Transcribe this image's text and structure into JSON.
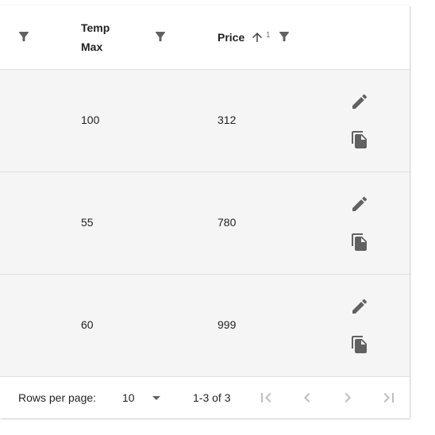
{
  "table": {
    "columns": [
      {
        "label": "",
        "filter_icon": "filter-icon"
      },
      {
        "label_line1": "Temp",
        "label_line2": "Max",
        "filter_icon": "filter-icon"
      },
      {
        "label": "Price",
        "sort_icon": "arrow-up-icon",
        "sort_order": "1",
        "filter_icon": "filter-icon"
      }
    ],
    "rows": [
      {
        "temp_max": "100",
        "price": "312",
        "actions": [
          "edit-icon",
          "copy-icon"
        ]
      },
      {
        "temp_max": "55",
        "price": "780",
        "actions": [
          "edit-icon",
          "copy-icon"
        ]
      },
      {
        "temp_max": "60",
        "price": "999",
        "actions": [
          "edit-icon",
          "copy-icon"
        ]
      }
    ]
  },
  "pagination": {
    "rows_per_page_label": "Rows per page:",
    "rows_per_page_value": "10",
    "range_text": "1-3 of 3",
    "icons": [
      "first-page-icon",
      "chevron-left-icon",
      "chevron-right-icon",
      "last-page-icon"
    ]
  },
  "colors": {
    "row_background": "#f5f5f5",
    "divider": "#e0e0e0",
    "icon": "#616161",
    "disabled_icon": "#bdbdbd"
  }
}
